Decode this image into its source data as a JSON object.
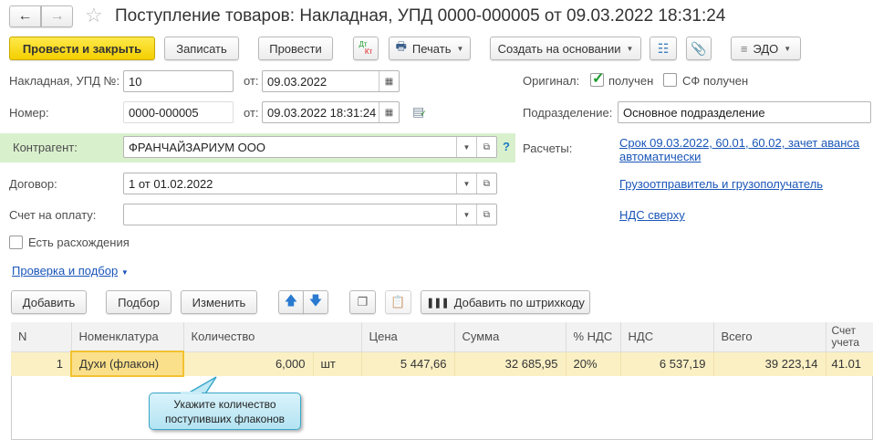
{
  "window": {
    "title": "Поступление товаров: Накладная, УПД 0000-000005 от 09.03.2022 18:31:24"
  },
  "toolbar": {
    "post_close": "Провести и закрыть",
    "save": "Записать",
    "post": "Провести",
    "dtkt_dt": "Дт",
    "dtkt_kt": "Кт",
    "print": "Печать",
    "create_based": "Создать на основании",
    "edo": "ЭДО"
  },
  "form": {
    "invoice_label": "Накладная, УПД №:",
    "invoice_value": "10",
    "from_label": "от:",
    "invoice_date": "09.03.2022",
    "number_label": "Номер:",
    "number_value": "0000-000005",
    "number_date": "09.03.2022 18:31:24",
    "original_label": "Оригинал:",
    "original_received": "получен",
    "original_checked": true,
    "sf_received": "СФ получен",
    "sf_checked": false,
    "division_label": "Подразделение:",
    "division_value": "Основное подразделение",
    "counterparty_label": "Контрагент:",
    "counterparty_value": "ФРАНЧАЙЗАРИУМ ООО",
    "help": "?",
    "settlements_label": "Расчеты:",
    "settlements_link": "Срок 09.03.2022, 60.01, 60.02, зачет аванса автоматически",
    "contract_label": "Договор:",
    "contract_value": "1 от 01.02.2022",
    "shipper_link": "Грузоотправитель и грузополучатель",
    "payment_label": "Счет на оплату:",
    "payment_value": "",
    "vat_link": "НДС сверху",
    "discrepancy_label": "Есть расхождения",
    "discrepancy_checked": false,
    "check_link": "Проверка и подбор"
  },
  "table_toolbar": {
    "add": "Добавить",
    "pick": "Подбор",
    "edit": "Изменить",
    "barcode": "Добавить по штрихкоду"
  },
  "table": {
    "headers": [
      "N",
      "Номенклатура",
      "Количество",
      "Цена",
      "Сумма",
      "% НДС",
      "НДС",
      "Всего",
      "Счет учета"
    ],
    "rows": [
      {
        "n": "1",
        "item": "Духи (флакон)",
        "qty": "6,000",
        "unit": "шт",
        "price": "5 447,66",
        "sum": "32 685,95",
        "vat_rate": "20%",
        "vat": "6 537,19",
        "total": "39 223,14",
        "account": "41.01"
      }
    ]
  },
  "callout": {
    "line1": "Укажите количество",
    "line2": "поступивших флаконов"
  }
}
